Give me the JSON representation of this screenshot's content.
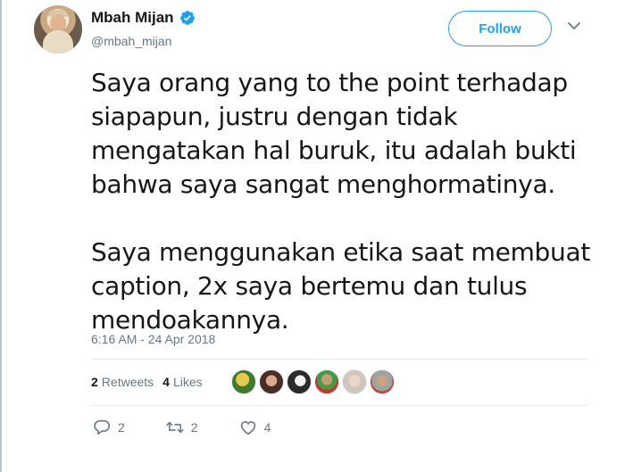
{
  "tweet": {
    "author": {
      "name": "Mbah Mijan",
      "handle": "@mbah_mijan",
      "verified": true
    },
    "follow_label": "Follow",
    "text_paragraphs": [
      "Saya orang yang to the point terhadap\nsiapapun, justru dengan tidak\nmengatakan hal buruk, itu adalah bukti\nbahwa saya sangat menghormatinya.",
      "Saya menggunakan etika saat membuat\ncaption, 2x saya bertemu dan tulus\nmendoakannya."
    ],
    "timestamp": "6:16 AM - 24 Apr 2018",
    "stats": {
      "retweets_count": "2",
      "retweets_label": "Retweets",
      "likes_count": "4",
      "likes_label": "Likes"
    },
    "actions": {
      "reply_count": "2",
      "retweet_count": "2",
      "like_count": "4"
    }
  },
  "colors": {
    "accent": "#1da1f2",
    "text_primary": "#14171a",
    "text_secondary": "#657786",
    "divider": "#e6ecf0"
  },
  "icons": [
    "verified-badge-icon",
    "chevron-down-icon",
    "reply-icon",
    "retweet-icon",
    "like-heart-icon"
  ]
}
